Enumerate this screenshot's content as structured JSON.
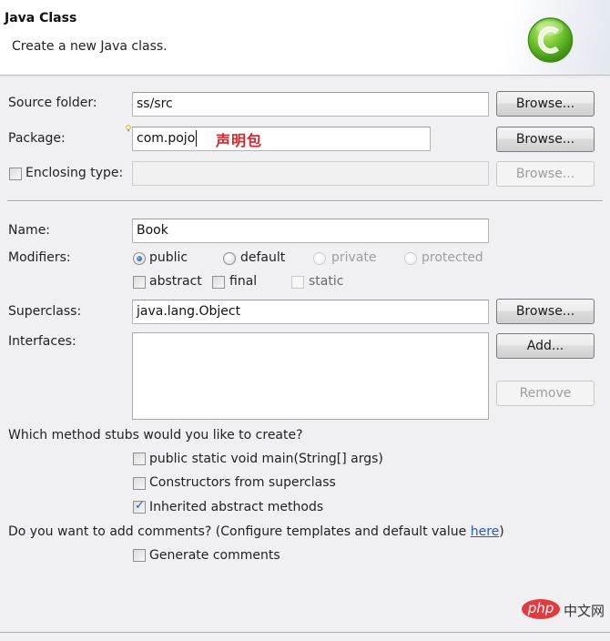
{
  "header": {
    "title": "Java Class",
    "description": "Create a new Java class.",
    "icon": "java-class-c-icon"
  },
  "form": {
    "source_folder": {
      "label": "Source folder:",
      "value": "ss/src",
      "browse_label": "Browse..."
    },
    "package": {
      "label": "Package:",
      "value": "com.pojo",
      "browse_label": "Browse...",
      "annotation": "声明包"
    },
    "enclosing_type": {
      "label": "Enclosing type:",
      "checked": false,
      "value": "",
      "browse_label": "Browse...",
      "enabled": false
    },
    "name": {
      "label": "Name:",
      "value": "Book"
    },
    "modifiers": {
      "label": "Modifiers:",
      "access": [
        {
          "label": "public",
          "selected": true,
          "enabled": true
        },
        {
          "label": "default",
          "selected": false,
          "enabled": true
        },
        {
          "label": "private",
          "selected": false,
          "enabled": false
        },
        {
          "label": "protected",
          "selected": false,
          "enabled": false
        }
      ],
      "flags": [
        {
          "label": "abstract",
          "checked": false,
          "enabled": true
        },
        {
          "label": "final",
          "checked": false,
          "enabled": true
        },
        {
          "label": "static",
          "checked": false,
          "enabled": false
        }
      ]
    },
    "superclass": {
      "label": "Superclass:",
      "value": "java.lang.Object",
      "browse_label": "Browse..."
    },
    "interfaces": {
      "label": "Interfaces:",
      "items": [],
      "add_label": "Add...",
      "remove_label": "Remove"
    },
    "method_stubs": {
      "question": "Which method stubs would you like to create?",
      "options": [
        {
          "label": "public static void main(String[] args)",
          "checked": false
        },
        {
          "label": "Constructors from superclass",
          "checked": false
        },
        {
          "label": "Inherited abstract methods",
          "checked": true
        }
      ]
    },
    "comments": {
      "question_prefix": "Do you want to add comments? (Configure templates and default value ",
      "link_text": "here",
      "question_suffix": ")",
      "option": {
        "label": "Generate comments",
        "checked": false
      }
    }
  },
  "watermark": {
    "logo_text": "php",
    "site_text": "中文网"
  },
  "colors": {
    "link": "#1e5ec8",
    "annotation": "#d7262b",
    "icon_green": "#5db82a"
  }
}
